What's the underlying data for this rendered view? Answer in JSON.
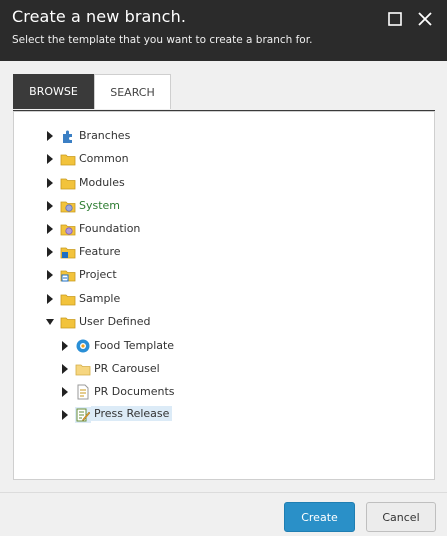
{
  "dialog": {
    "title": "Create a new branch.",
    "subtitle": "Select the template that you want to create a branch for."
  },
  "tabs": [
    {
      "label": "BROWSE",
      "active": true
    },
    {
      "label": "SEARCH",
      "active": false
    }
  ],
  "tree": {
    "items": [
      {
        "label": "Branches",
        "icon": "branches-puzzle-icon",
        "expanded": false
      },
      {
        "label": "Common",
        "icon": "folder-icon",
        "expanded": false
      },
      {
        "label": "Modules",
        "icon": "folder-icon",
        "expanded": false
      },
      {
        "label": "System",
        "icon": "system-folder-icon",
        "expanded": false,
        "color": "#2e7d32"
      },
      {
        "label": "Foundation",
        "icon": "foundation-folder-icon",
        "expanded": false
      },
      {
        "label": "Feature",
        "icon": "feature-folder-icon",
        "expanded": false
      },
      {
        "label": "Project",
        "icon": "project-folder-icon",
        "expanded": false
      },
      {
        "label": "Sample",
        "icon": "folder-icon",
        "expanded": false
      },
      {
        "label": "User Defined",
        "icon": "folder-icon",
        "expanded": true
      },
      {
        "label": "Food Template",
        "icon": "template-icon",
        "expanded": false
      },
      {
        "label": "PR Carousel",
        "icon": "folder-icon",
        "expanded": false
      },
      {
        "label": "PR Documents",
        "icon": "document-icon",
        "expanded": false
      },
      {
        "label": "Press Release",
        "icon": "press-release-icon",
        "expanded": false,
        "selected": true
      }
    ]
  },
  "buttons": {
    "create": "Create",
    "cancel": "Cancel"
  },
  "colors": {
    "titlebar": "#2b2b2b",
    "accent": "#2a90c8",
    "selection": "#dcebf7"
  }
}
